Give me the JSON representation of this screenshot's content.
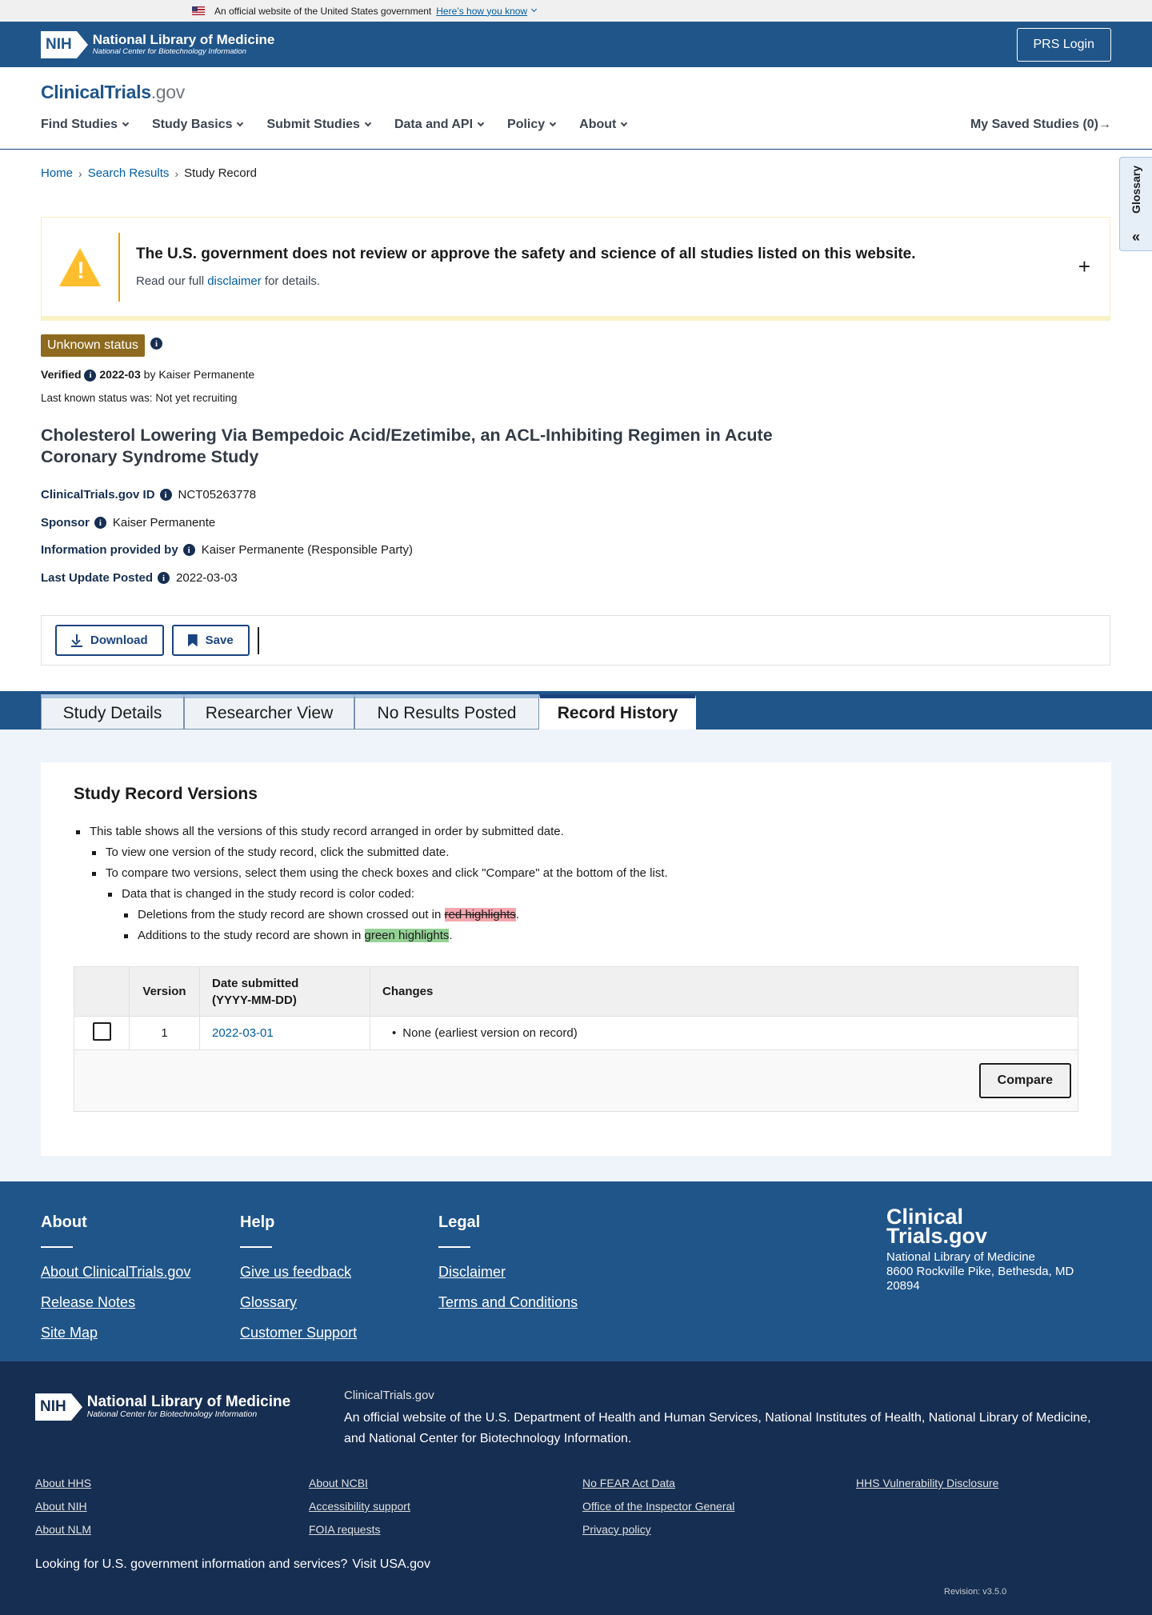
{
  "gov_banner": {
    "text": "An official website of the United States government",
    "link": "Here’s how you know"
  },
  "nlm": {
    "nih": "NIH",
    "title": "National Library of Medicine",
    "subtitle": "National Center for Biotechnology Information",
    "prs_login": "PRS Login"
  },
  "site": {
    "logo_main": "ClinicalTrials",
    "logo_gov": ".gov"
  },
  "nav": [
    "Find Studies",
    "Study Basics",
    "Submit Studies",
    "Data and API",
    "Policy",
    "About"
  ],
  "saved_studies": "My Saved Studies (0)→",
  "glossary": "Glossary",
  "breadcrumb": {
    "home": "Home",
    "search": "Search Results",
    "current": "Study Record"
  },
  "warning": {
    "title": "The U.S. government does not review or approve the safety and science of all studies listed on this website.",
    "pre": "Read our full ",
    "link": "disclaimer",
    "post": " for details.",
    "toggle": "+"
  },
  "status": {
    "badge": "Unknown status",
    "verified_label": "Verified",
    "verified_date": "2022-03",
    "verified_by": "by Kaiser Permanente",
    "last_known": "Last known status was: Not yet recruiting"
  },
  "study": {
    "title": "Cholesterol Lowering Via Bempedoic Acid/Ezetimibe, an ACL-Inhibiting Regimen in Acute Coronary Syndrome Study",
    "id_label": "ClinicalTrials.gov ID",
    "id_value": "NCT05263778",
    "sponsor_label": "Sponsor",
    "sponsor_value": "Kaiser Permanente",
    "info_label": "Information provided by",
    "info_value": "Kaiser Permanente (Responsible Party)",
    "update_label": "Last Update Posted",
    "update_value": "2022-03-03"
  },
  "actions": {
    "download": "Download",
    "save": "Save"
  },
  "tabs": [
    "Study Details",
    "Researcher View",
    "No Results Posted",
    "Record History"
  ],
  "versions": {
    "heading": "Study Record Versions",
    "b1": "This table shows all the versions of this study record arranged in order by submitted date.",
    "b2": "To view one version of the study record, click the submitted date.",
    "b3": "To compare two versions, select them using the check boxes and click \"Compare\" at the bottom of the list.",
    "b4": "Data that is changed in the study record is color coded:",
    "b5_pre": "Deletions from the study record are shown crossed out in ",
    "b5_hl": "red highlights",
    "b5_post": ".",
    "b6_pre": "Additions to the study record are shown in ",
    "b6_hl": "green highlights",
    "b6_post": ".",
    "col_version": "Version",
    "col_date1": "Date submitted",
    "col_date2": "(YYYY-MM-DD)",
    "col_changes": "Changes",
    "row_version": "1",
    "row_date": "2022-03-01",
    "row_change": "None (earliest version on record)",
    "compare": "Compare"
  },
  "footer": {
    "about_h": "About",
    "about_links": [
      "About ClinicalTrials.gov",
      "Release Notes",
      "Site Map"
    ],
    "help_h": "Help",
    "help_links": [
      "Give us feedback",
      "Glossary",
      "Customer Support"
    ],
    "legal_h": "Legal",
    "legal_links": [
      "Disclaimer",
      "Terms and Conditions"
    ],
    "brand1": "Clinical",
    "brand2": "Trials.gov",
    "addr1": "National Library of Medicine",
    "addr2": "8600 Rockville Pike, Bethesda, MD",
    "addr3": "20894"
  },
  "footer_nlm": {
    "site": "ClinicalTrials.gov",
    "official_pre": "An official website of the ",
    "hhs": "U.S. Department of Health and Human Services",
    "nih": "National Institutes of Health",
    "nlm": "National Library of Medicine",
    "and": "and ",
    "ncbi": "National Center for Biotechnology Information",
    "links": [
      "About HHS",
      "About NIH",
      "About NLM",
      "About NCBI",
      "Accessibility support",
      "FOIA requests",
      "No FEAR Act Data",
      "Office of the Inspector General",
      "Privacy policy",
      "HHS Vulnerability Disclosure"
    ],
    "looking": "Looking for U.S. government information and services?",
    "usa": "Visit USA.gov",
    "revision": "Revision: v3.5.0"
  }
}
